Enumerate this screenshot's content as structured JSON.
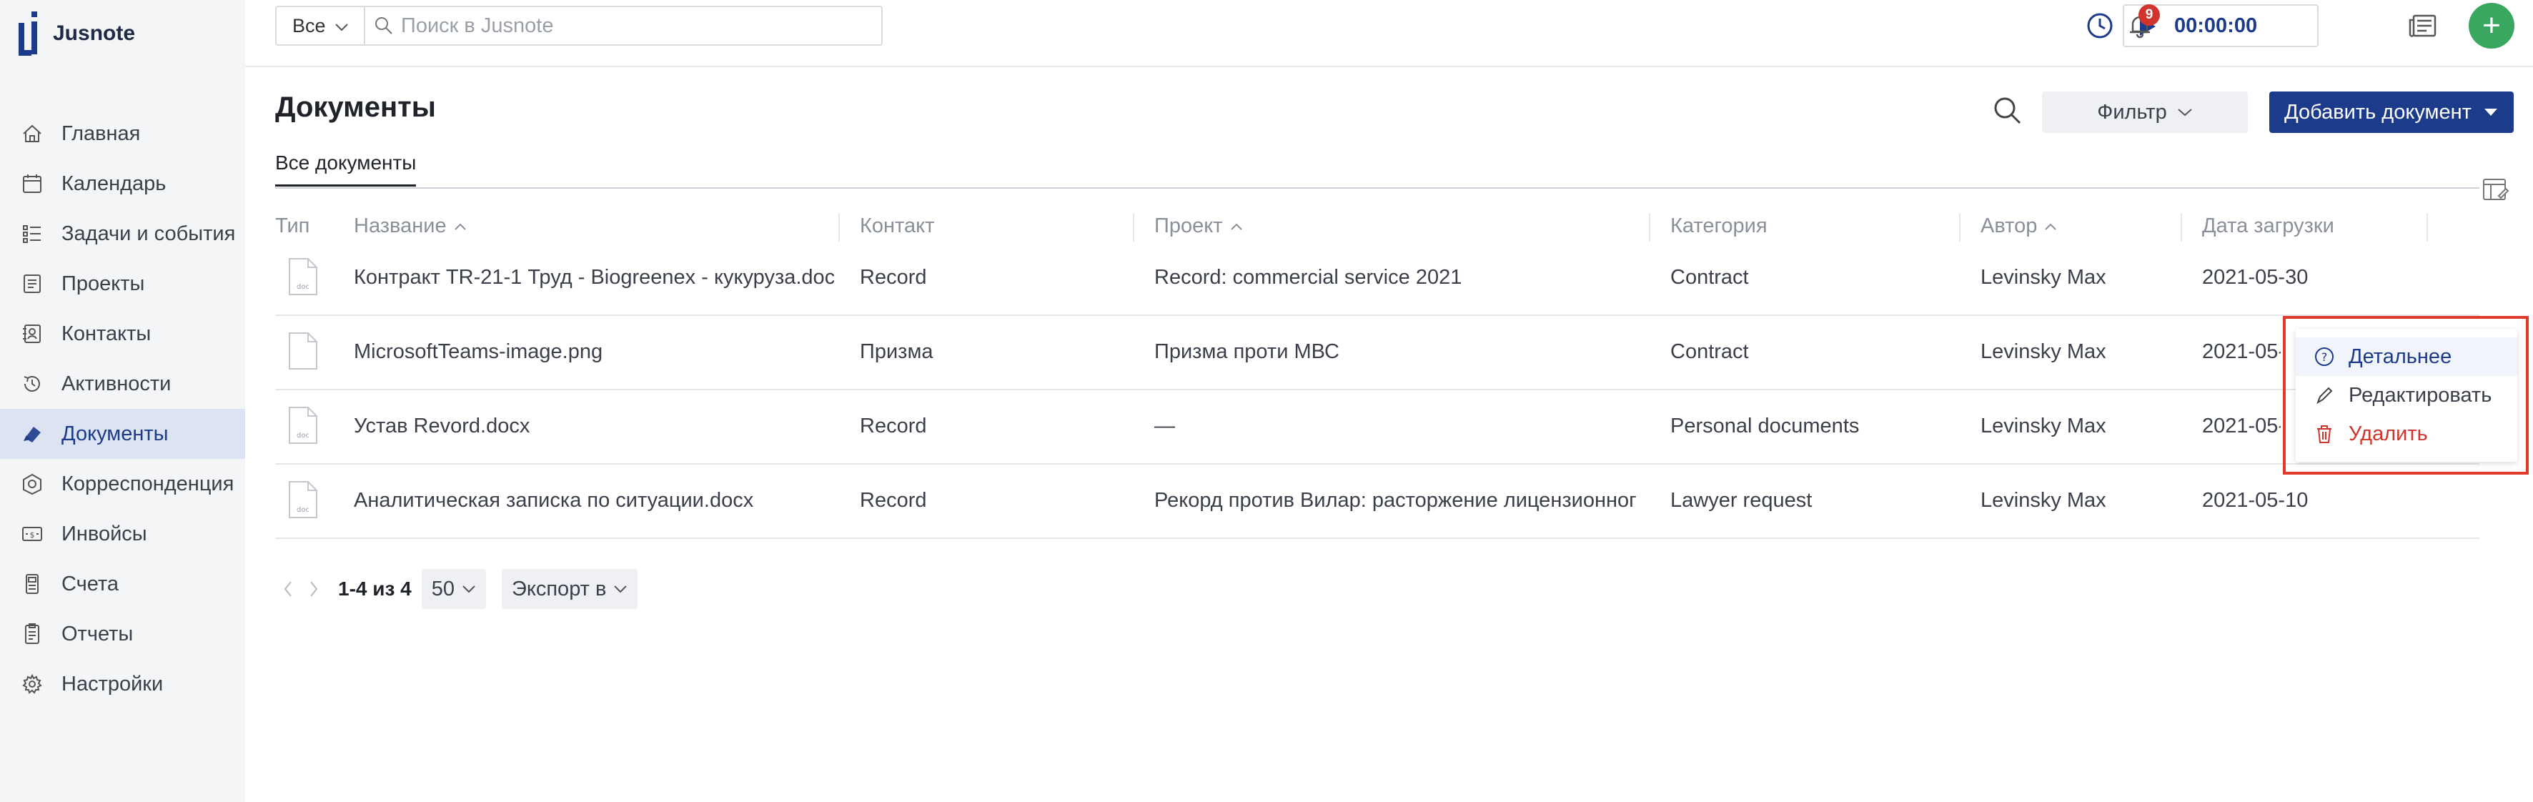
{
  "app": {
    "name": "Jusnote"
  },
  "sidebar": {
    "items": [
      {
        "label": "Главная",
        "icon": "home-icon"
      },
      {
        "label": "Календарь",
        "icon": "calendar-icon"
      },
      {
        "label": "Задачи и события",
        "icon": "tasks-icon"
      },
      {
        "label": "Проекты",
        "icon": "projects-icon"
      },
      {
        "label": "Контакты",
        "icon": "contacts-icon"
      },
      {
        "label": "Активности",
        "icon": "activity-icon"
      },
      {
        "label": "Документы",
        "icon": "documents-icon",
        "active": true
      },
      {
        "label": "Корреспонденция",
        "icon": "correspondence-icon"
      },
      {
        "label": "Инвойсы",
        "icon": "invoice-icon"
      },
      {
        "label": "Счета",
        "icon": "accounts-icon"
      },
      {
        "label": "Отчеты",
        "icon": "reports-icon"
      },
      {
        "label": "Настройки",
        "icon": "settings-icon"
      }
    ]
  },
  "topbar": {
    "scope": "Все",
    "search_placeholder": "Поиск в Jusnote",
    "timer": "00:00:00",
    "notifications_count": "9",
    "add_label": "+"
  },
  "page": {
    "title": "Документы",
    "filter_label": "Фильтр",
    "add_document_label": "Добавить документ",
    "tab": "Все документы"
  },
  "table": {
    "columns": [
      "Тип",
      "Название",
      "Контакт",
      "Проект",
      "Категория",
      "Автор",
      "Дата загрузки"
    ],
    "rows": [
      {
        "type": "doc",
        "name": "Контракт TR-21-1 Труд - Biogreenex - кукуруза.doc",
        "contact": "Record",
        "project": "Record: commercial service 2021",
        "category": "Contract",
        "author": "Levinsky Max",
        "date": "2021-05-30"
      },
      {
        "type": "",
        "name": "MicrosoftTeams-image.png",
        "contact": "Призма",
        "project": "Призма проти МВС",
        "category": "Contract",
        "author": "Levinsky Max",
        "date": "2021-05-"
      },
      {
        "type": "doc",
        "name": "Устав Revord.docx",
        "contact": "Record",
        "project": "—",
        "category": "Personal documents",
        "author": "Levinsky Max",
        "date": "2021-05-"
      },
      {
        "type": "doc",
        "name": "Аналитическая записка по ситуации.docx",
        "contact": "Record",
        "project": "Рекорд против Вилар: расторжение лицензионног",
        "category": "Lawyer request",
        "author": "Levinsky Max",
        "date": "2021-05-10"
      }
    ]
  },
  "pagination": {
    "range": "1-4 из 4",
    "page_size": "50",
    "export_label": "Экспорт в"
  },
  "context_menu": {
    "items": [
      {
        "label": "Детальнее",
        "icon": "help-circle-icon",
        "color": "#1d3b8b"
      },
      {
        "label": "Редактировать",
        "icon": "pencil-icon",
        "color": "#3a3f4a"
      },
      {
        "label": "Удалить",
        "icon": "trash-icon",
        "color": "#d0342c"
      }
    ]
  },
  "colors": {
    "primary": "#1d3b8b",
    "accent_green": "#3aa760",
    "danger": "#d0342c",
    "highlight_border": "#e03a2c"
  }
}
